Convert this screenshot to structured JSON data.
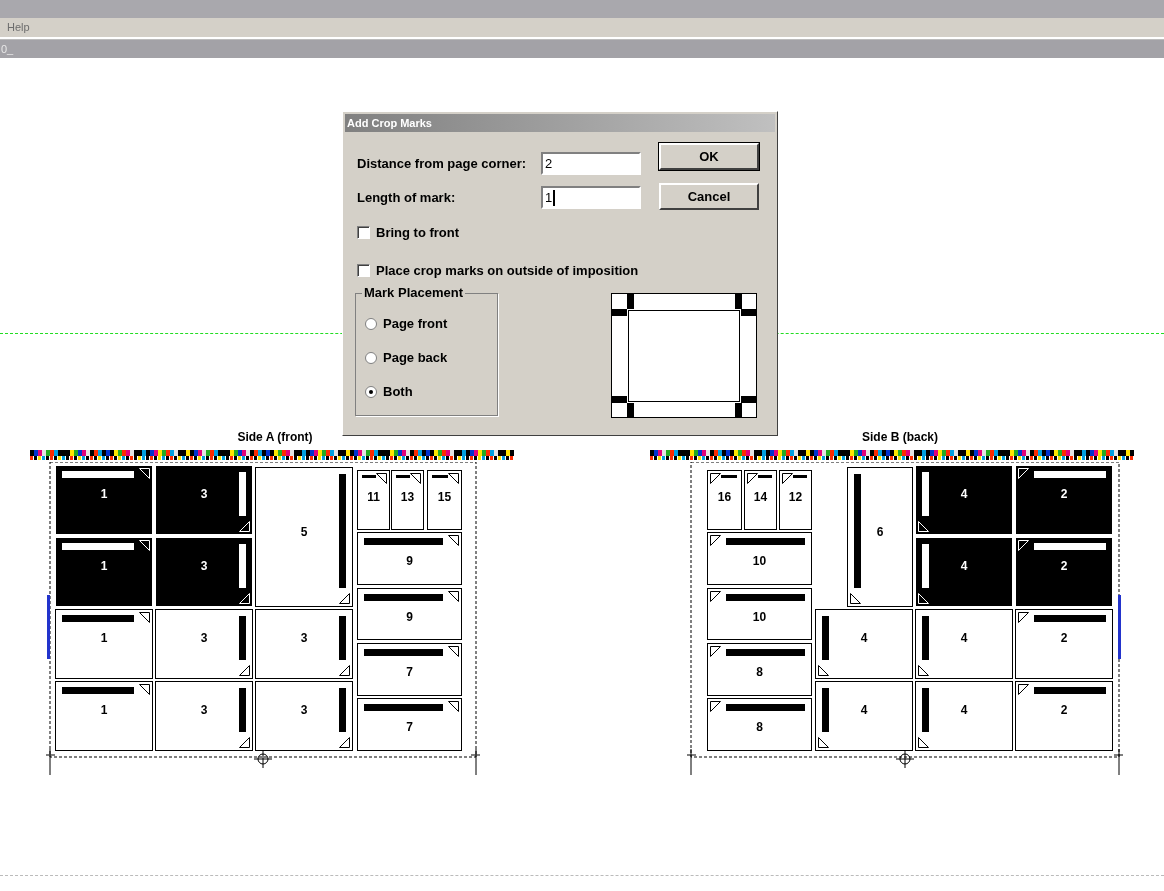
{
  "menu_bar": {
    "items": [
      "Help"
    ]
  },
  "tool_bar": {
    "text": "0_"
  },
  "dialog": {
    "title": "Add Crop Marks",
    "fields": [
      {
        "label": "Distance from page corner:",
        "value": "2",
        "focused": false
      },
      {
        "label": "Length of mark:",
        "value": "1",
        "focused": true
      }
    ],
    "buttons": [
      {
        "label": "OK",
        "default": true
      },
      {
        "label": "Cancel",
        "default": false
      }
    ],
    "checkboxes": [
      {
        "label": "Bring to front",
        "checked": false
      },
      {
        "label": "Place crop marks on outside of imposition",
        "checked": false
      }
    ],
    "placement": {
      "title": "Mark Placement",
      "options": [
        {
          "label": "Page front",
          "selected": false
        },
        {
          "label": "Page back",
          "selected": false
        },
        {
          "label": "Both",
          "selected": true
        }
      ]
    }
  },
  "sides": [
    {
      "title": "Side A (front)",
      "pages": [
        {
          "number": "1",
          "kind": "top",
          "selected": true
        },
        {
          "number": "3",
          "kind": "right",
          "selected": true
        },
        {
          "number": "5",
          "kind": "right",
          "selected": false
        },
        {
          "number": "11",
          "kind": "top",
          "selected": false
        },
        {
          "number": "13",
          "kind": "top",
          "selected": false
        },
        {
          "number": "15",
          "kind": "top",
          "selected": false
        },
        {
          "number": "9",
          "kind": "top",
          "selected": false
        },
        {
          "number": "1",
          "kind": "top",
          "selected": true
        },
        {
          "number": "3",
          "kind": "right",
          "selected": true
        },
        {
          "number": "9",
          "kind": "top",
          "selected": false
        },
        {
          "number": "1",
          "kind": "top",
          "selected": false
        },
        {
          "number": "3",
          "kind": "right",
          "selected": false
        },
        {
          "number": "3",
          "kind": "right",
          "selected": false
        },
        {
          "number": "7",
          "kind": "top",
          "selected": false
        },
        {
          "number": "1",
          "kind": "top",
          "selected": false
        },
        {
          "number": "3",
          "kind": "right",
          "selected": false
        },
        {
          "number": "3",
          "kind": "right",
          "selected": false
        },
        {
          "number": "7",
          "kind": "top",
          "selected": false
        }
      ]
    },
    {
      "title": "Side B (back)",
      "pages": [
        {
          "number": "16",
          "kind": "top_mirror",
          "selected": false
        },
        {
          "number": "14",
          "kind": "top_mirror",
          "selected": false
        },
        {
          "number": "12",
          "kind": "top_mirror",
          "selected": false
        },
        {
          "number": "6",
          "kind": "left",
          "selected": false
        },
        {
          "number": "4",
          "kind": "left",
          "selected": true
        },
        {
          "number": "2",
          "kind": "top_mirror",
          "selected": true
        },
        {
          "number": "10",
          "kind": "top_mirror",
          "selected": false
        },
        {
          "number": "4",
          "kind": "left",
          "selected": true
        },
        {
          "number": "2",
          "kind": "top_mirror",
          "selected": true
        },
        {
          "number": "10",
          "kind": "top_mirror",
          "selected": false
        },
        {
          "number": "8",
          "kind": "top_mirror",
          "selected": false
        },
        {
          "number": "4",
          "kind": "left",
          "selected": false
        },
        {
          "number": "4",
          "kind": "left",
          "selected": false
        },
        {
          "number": "2",
          "kind": "top_mirror",
          "selected": false
        },
        {
          "number": "8",
          "kind": "top_mirror",
          "selected": false
        },
        {
          "number": "4",
          "kind": "left",
          "selected": false
        },
        {
          "number": "4",
          "kind": "left",
          "selected": false
        },
        {
          "number": "2",
          "kind": "top_mirror",
          "selected": false
        }
      ]
    }
  ]
}
